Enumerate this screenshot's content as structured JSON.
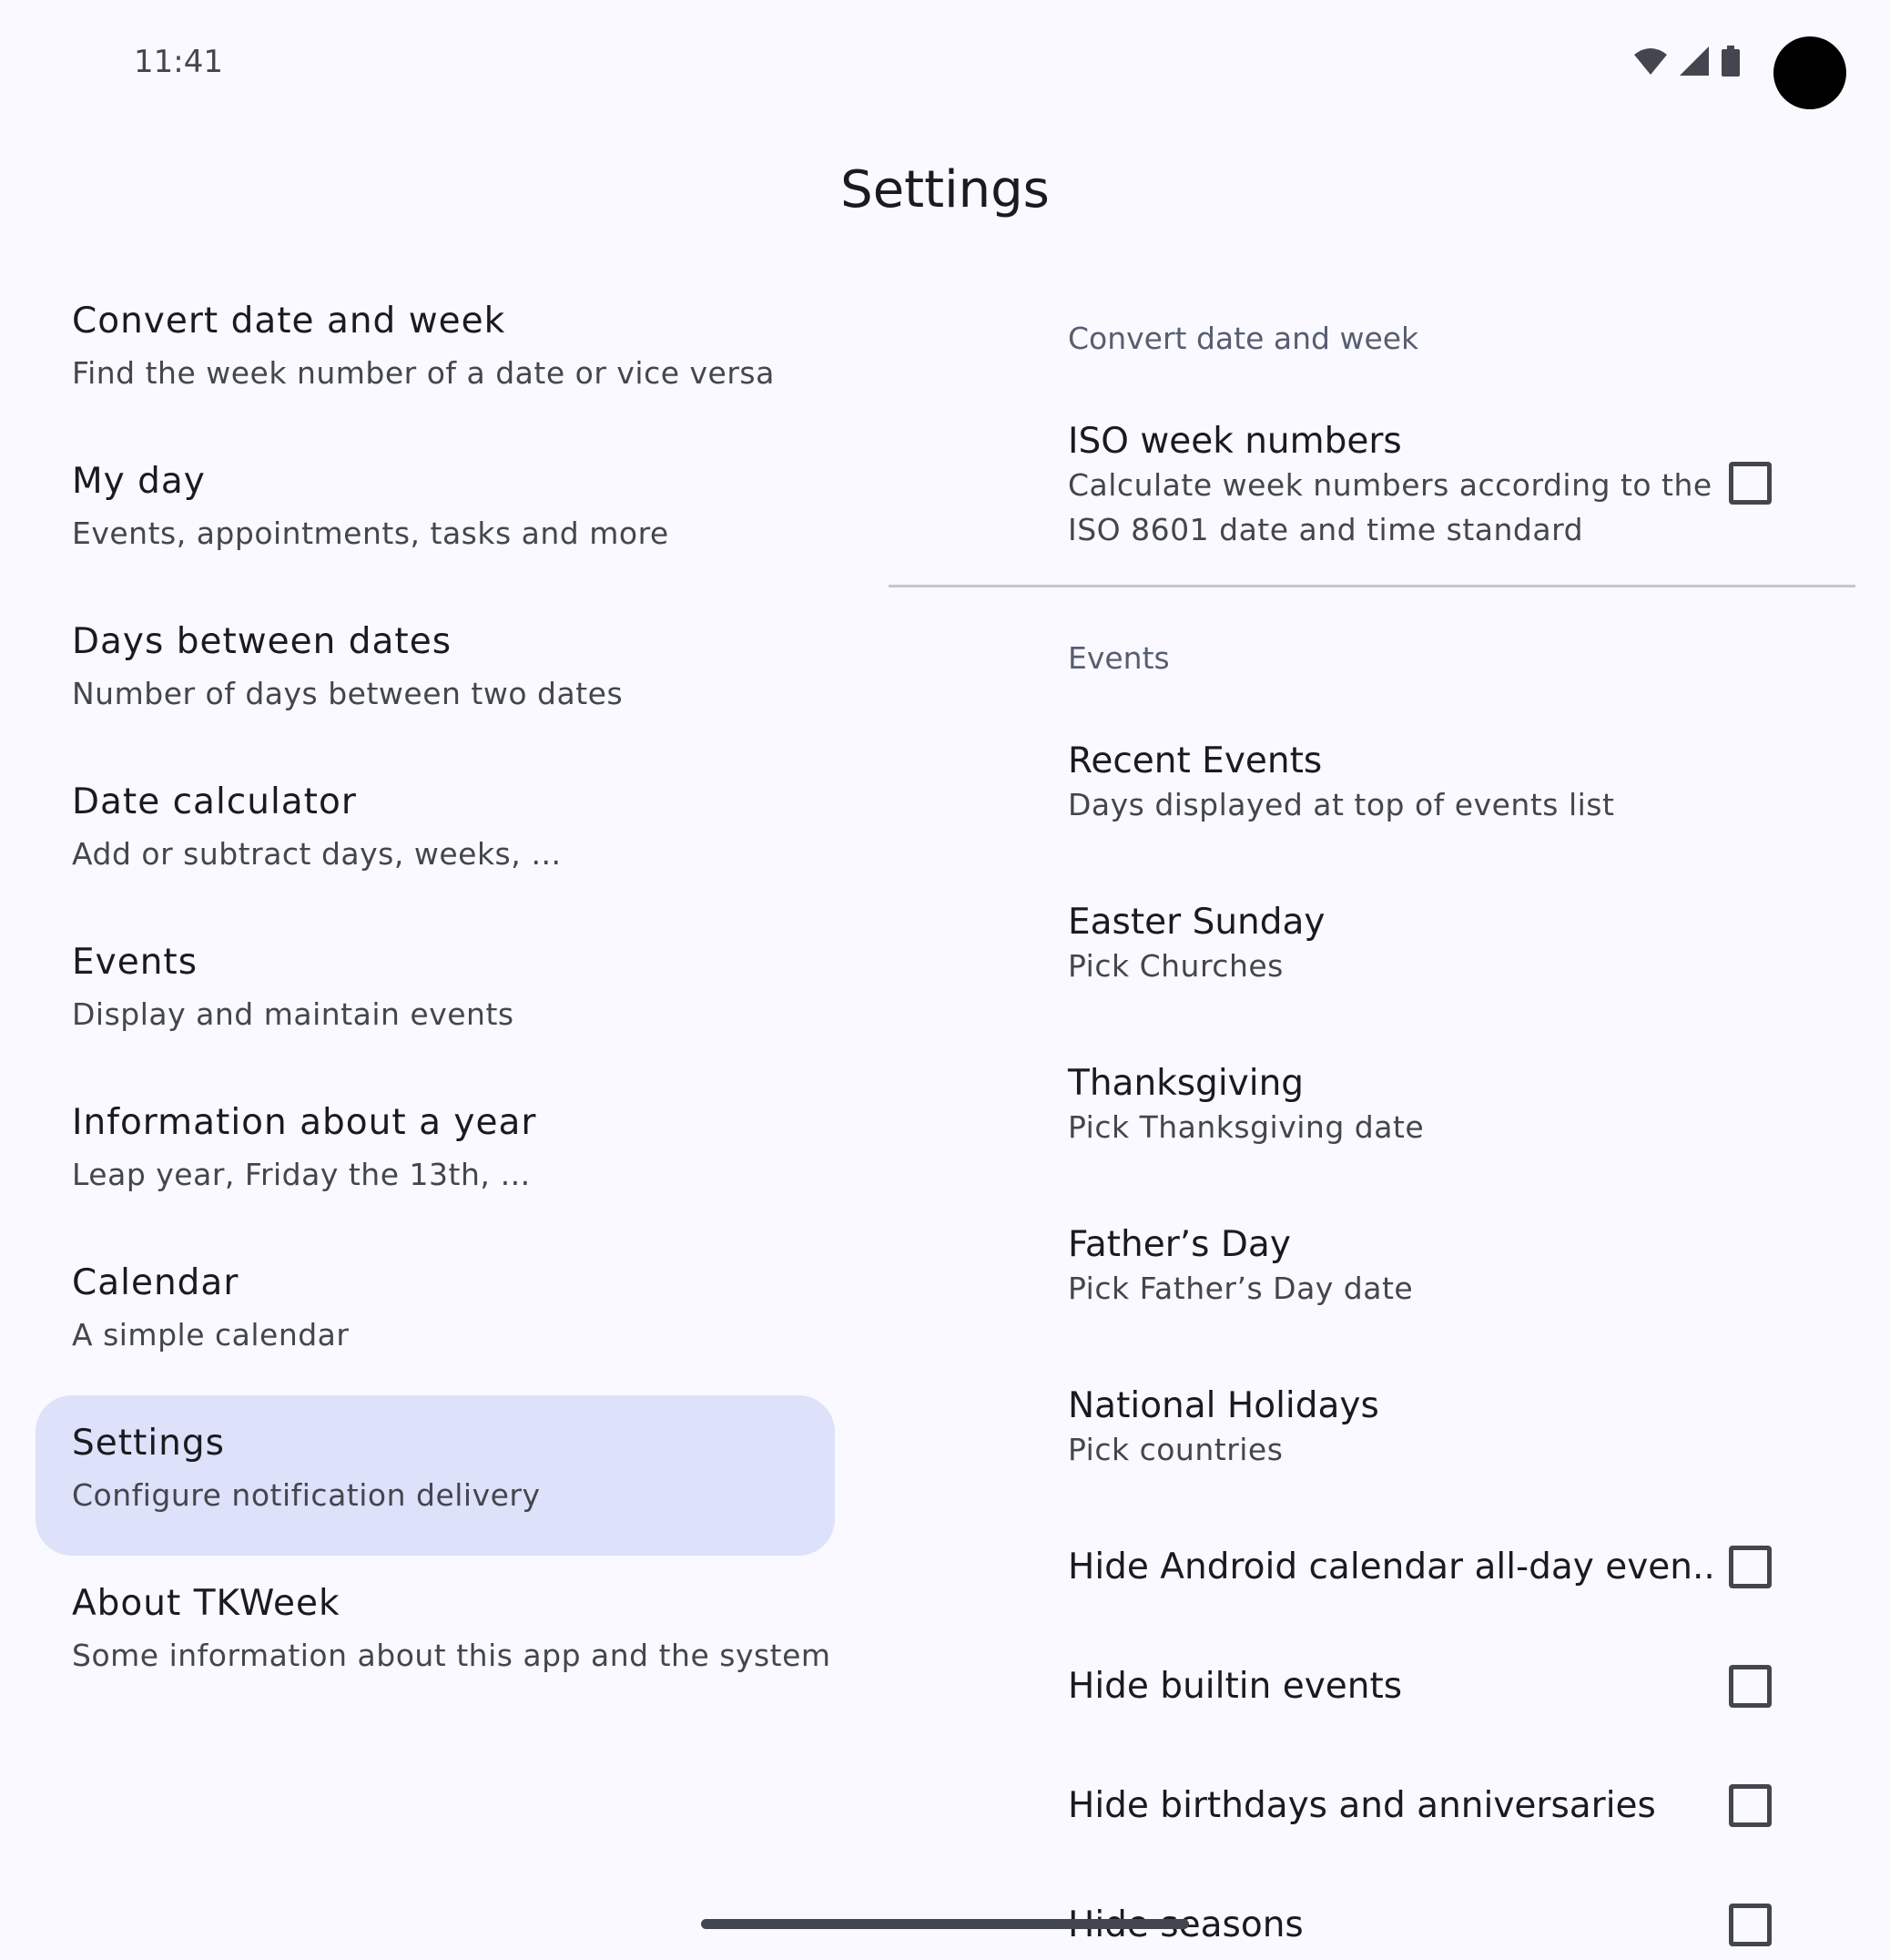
{
  "status_bar": {
    "time": "11:41"
  },
  "header": {
    "title": "Settings"
  },
  "nav": {
    "items": [
      {
        "title": "Convert date and week",
        "subtitle": "Find the week number of a date or vice versa"
      },
      {
        "title": "My day",
        "subtitle": "Events, appointments, tasks and more"
      },
      {
        "title": "Days between dates",
        "subtitle": "Number of days between two dates"
      },
      {
        "title": "Date calculator",
        "subtitle": "Add or subtract days, weeks, …"
      },
      {
        "title": "Events",
        "subtitle": "Display and maintain events"
      },
      {
        "title": "Information about a year",
        "subtitle": "Leap year, Friday the 13th, …"
      },
      {
        "title": "Calendar",
        "subtitle": "A simple calendar"
      },
      {
        "title": "Settings",
        "subtitle": "Configure notification delivery"
      },
      {
        "title": "About TKWeek",
        "subtitle": "Some information about this app and the system"
      }
    ]
  },
  "prefs": {
    "section_convert": "Convert date and week",
    "iso_title": "ISO week numbers",
    "iso_summary_line1": "Calculate week numbers according to the",
    "iso_summary_line2": "ISO 8601 date and time standard",
    "section_events": "Events",
    "recent_title": "Recent Events",
    "recent_summary": "Days displayed at top of events list",
    "easter_title": "Easter Sunday",
    "easter_summary": "Pick Churches",
    "thanks_title": "Thanksgiving",
    "thanks_summary": "Pick Thanksgiving date",
    "fathers_title": "Father’s Day",
    "fathers_summary": "Pick Father’s Day date",
    "national_title": "National Holidays",
    "national_summary": "Pick countries",
    "hide_allday_title": "Hide Android calendar all-day even..",
    "hide_builtin_title": "Hide builtin events",
    "hide_birthdays_title": "Hide birthdays and anniversaries",
    "hide_seasons_title": "Hide seasons"
  },
  "colors": {
    "background": "#f9f9ff",
    "active_nav": "#dde1f9",
    "section_header": "#575e71"
  },
  "icons": [
    "wifi-icon",
    "signal-icon",
    "battery-icon"
  ]
}
